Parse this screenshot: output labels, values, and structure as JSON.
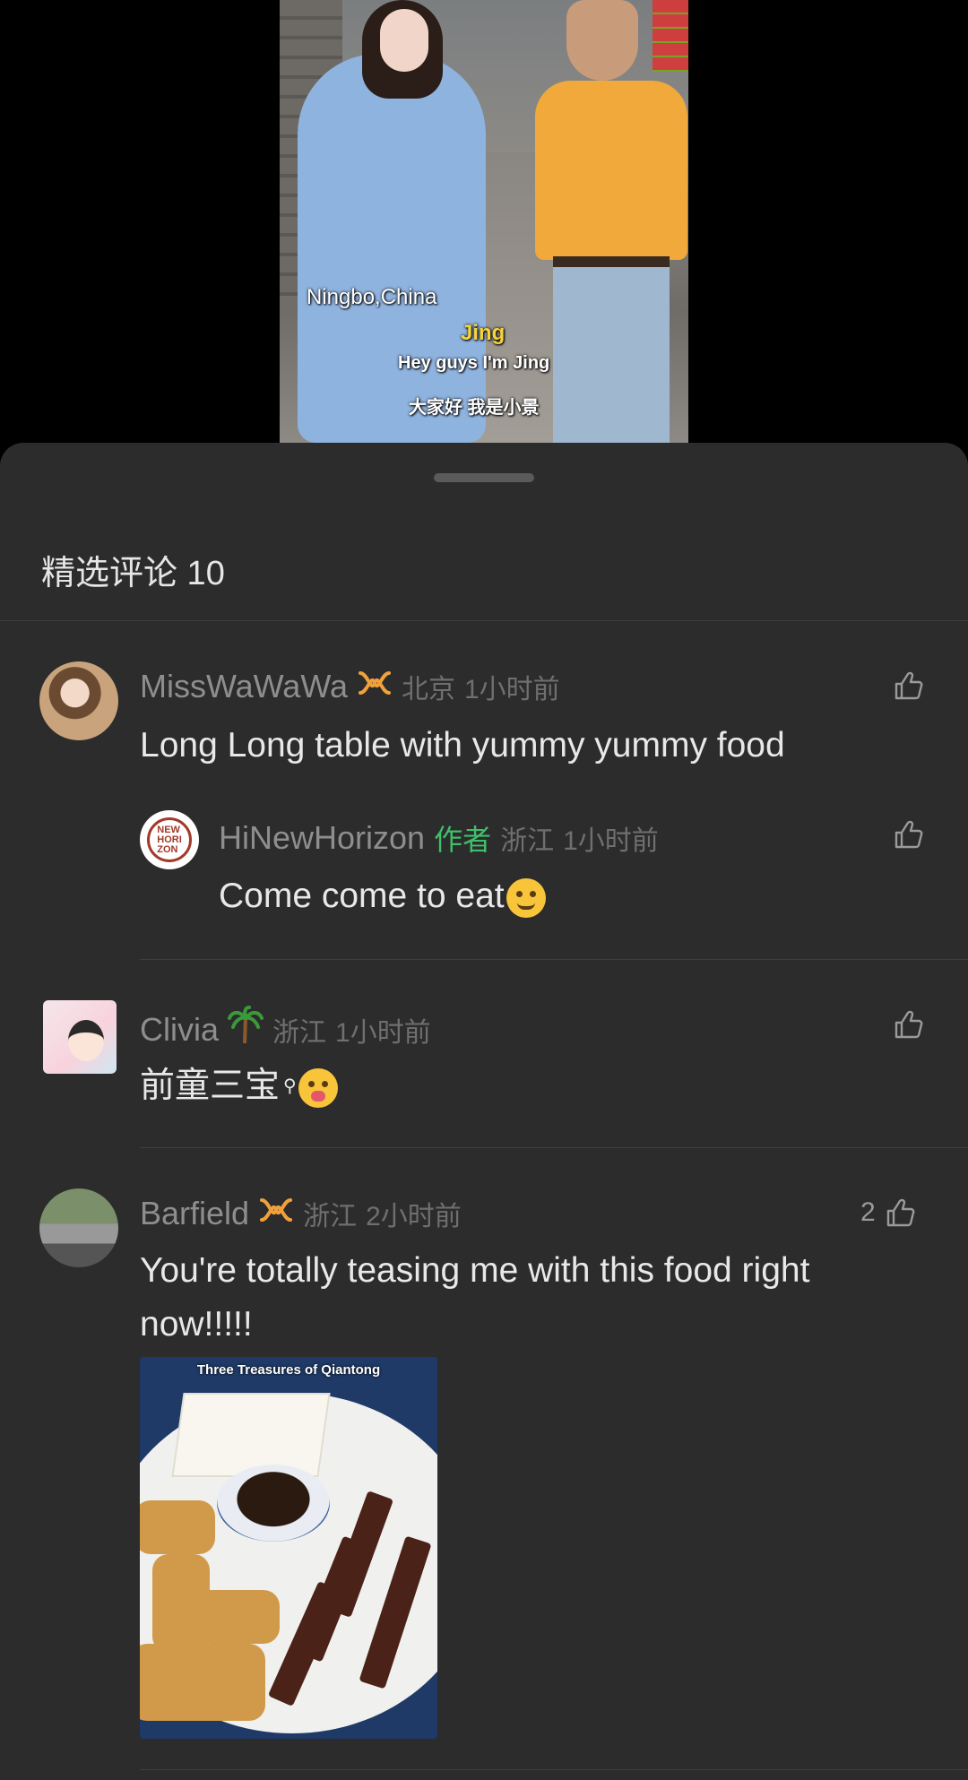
{
  "video": {
    "caption_location": "Ningbo,China",
    "caption_name": "Jing",
    "caption_line1": "Hey guys I'm Jing",
    "caption_line2": "大家好 我是小景"
  },
  "sheet": {
    "title": "精选评论 10"
  },
  "comments": [
    {
      "user": "MissWaWaWa",
      "badge_icon": "loop-badge-icon",
      "location": "北京",
      "time": "1小时前",
      "text": "Long Long table with yummy yummy food",
      "likes": "",
      "replies": [
        {
          "user": "HiNewHorizon",
          "author_tag": "作者",
          "location": "浙江",
          "time": "1小时前",
          "text": "Come come to eat",
          "emoji": "hugging-face-emoji",
          "avatar_text": "NEW HORIZON"
        }
      ]
    },
    {
      "user": "Clivia",
      "badge_icon": "palm-tree-icon",
      "location": "浙江",
      "time": "1小时前",
      "text": "前童三宝",
      "emoji": "zany-face-emoji",
      "likes": ""
    },
    {
      "user": "Barfield",
      "badge_icon": "loop-badge-icon",
      "location": "浙江",
      "time": "2小时前",
      "text": "You're totally teasing me with this food right now!!!!!",
      "likes": "2",
      "image_caption": "Three Treasures of Qiantong"
    }
  ],
  "colors": {
    "sheet_bg": "#2c2c2c",
    "author_green": "#3fbf6a",
    "badge_orange": "#f0a13c"
  }
}
